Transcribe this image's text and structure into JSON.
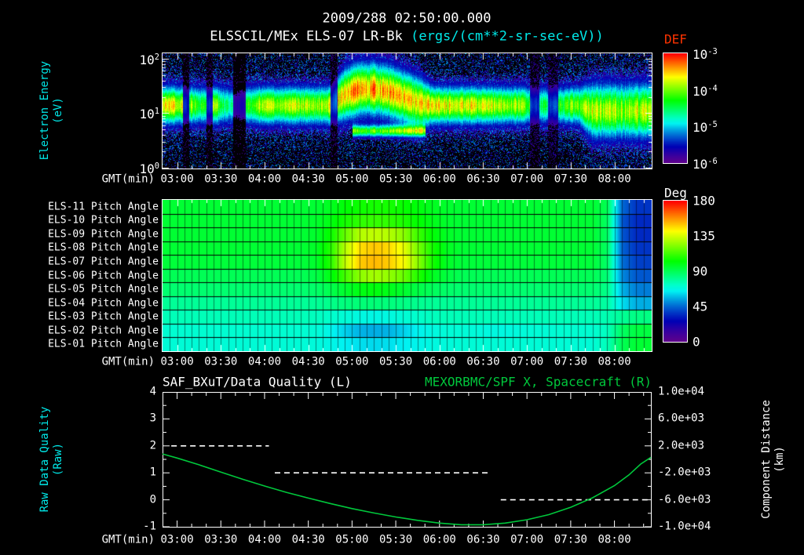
{
  "title": {
    "datetime": "2009/288 02:50:00.000",
    "instrument": "ELSSCIL/MEx ELS-07 LR-Bk",
    "units": " (ergs/(cm**2-sr-sec-eV))"
  },
  "colors": {
    "background": "#000000",
    "text": "#ffffff",
    "cyan": "#00e8e8",
    "green": "#00c83c",
    "red": "#ff3300"
  },
  "time_axis": {
    "label": "GMT(min)",
    "start": "02:50",
    "end": "08:25",
    "major_ticks": [
      "03:00",
      "03:30",
      "04:00",
      "04:30",
      "05:00",
      "05:30",
      "06:00",
      "06:30",
      "07:00",
      "07:30",
      "08:00"
    ],
    "minor_tick_minutes": 10
  },
  "chart_data": [
    {
      "type": "heatmap",
      "name": "electron-energy-spectrogram",
      "title": "ELSSCIL/MEx ELS-07 LR-Bk",
      "units": "ergs/(cm**2-sr-sec-eV)",
      "ylabel_lines": [
        "Electron Energy",
        "(eV)"
      ],
      "yscale": "log",
      "ylim_ev": [
        1,
        126
      ],
      "yticks": [
        {
          "text": "10^2",
          "log10": 2
        },
        {
          "text": "10^1",
          "log10": 1
        },
        {
          "text": "10^0",
          "log10": 0
        }
      ],
      "colorbar": {
        "label": "DEF",
        "ticks": [
          "10^-3",
          "10^-4",
          "10^-5",
          "10^-6"
        ],
        "range_log10": [
          -6,
          -3
        ]
      },
      "model": {
        "description": "bright electron flux band near 10-40 eV across full interval; elevated/intensified 04:50-05:40; faint low-energy band ~5 eV 05:00-05:50; dark dropout columns; blue/purple speckle background",
        "bin_minutes": 10,
        "band_amp": [
          0.78,
          0.72,
          0.58,
          0.68,
          0.45,
          0.55,
          0.7,
          0.72,
          0.74,
          0.72,
          0.7,
          0.76,
          0.85,
          0.88,
          0.87,
          0.84,
          0.8,
          0.78,
          0.8,
          0.78,
          0.76,
          0.75,
          0.74,
          0.72,
          0.7,
          0.55,
          0.5,
          0.6,
          0.68,
          0.75,
          0.73,
          0.7,
          0.74,
          0.76
        ],
        "band_center_log10": [
          1.15,
          1.15,
          1.15,
          1.15,
          1.15,
          1.15,
          1.15,
          1.15,
          1.15,
          1.15,
          1.15,
          1.15,
          1.35,
          1.45,
          1.45,
          1.4,
          1.3,
          1.2,
          1.15,
          1.15,
          1.15,
          1.15,
          1.15,
          1.15,
          1.15,
          1.15,
          1.15,
          1.15,
          1.15,
          1.05,
          1.05,
          1.05,
          1.05,
          1.05
        ],
        "band_sigma_log10": [
          0.22,
          0.22,
          0.22,
          0.22,
          0.22,
          0.22,
          0.22,
          0.22,
          0.22,
          0.22,
          0.22,
          0.22,
          0.3,
          0.3,
          0.3,
          0.3,
          0.3,
          0.3,
          0.22,
          0.22,
          0.22,
          0.22,
          0.22,
          0.22,
          0.22,
          0.22,
          0.22,
          0.22,
          0.22,
          0.32,
          0.32,
          0.32,
          0.32,
          0.32
        ],
        "low_band": {
          "start_min": 130,
          "end_min": 180,
          "center_log10": 0.68,
          "amp": 0.6,
          "sigma_log10": 0.07
        },
        "dark_stripes_min": [
          [
            14,
            18,
            0.25
          ],
          [
            30,
            34,
            0.3
          ],
          [
            48,
            57,
            0.2
          ],
          [
            115,
            120,
            0.3
          ],
          [
            252,
            258,
            0.35
          ],
          [
            264,
            271,
            0.4
          ]
        ]
      }
    },
    {
      "type": "heatmap",
      "name": "pitch-angle-panels",
      "rows": [
        "ELS-11 Pitch Angle",
        "ELS-10 Pitch Angle",
        "ELS-09 Pitch Angle",
        "ELS-08 Pitch Angle",
        "ELS-07 Pitch Angle",
        "ELS-06 Pitch Angle",
        "ELS-05 Pitch Angle",
        "ELS-04 Pitch Angle",
        "ELS-03 Pitch Angle",
        "ELS-02 Pitch Angle",
        "ELS-01 Pitch Angle"
      ],
      "colorbar": {
        "label": "Deg",
        "ticks": [
          180,
          135,
          90,
          45,
          0
        ],
        "range": [
          0,
          180
        ]
      },
      "bin_minutes": 10,
      "values_deg": [
        [
          95,
          95,
          95,
          95,
          95,
          95,
          95,
          95,
          95,
          95,
          95,
          98,
          102,
          105,
          106,
          106,
          104,
          101,
          98,
          96,
          95,
          95,
          95,
          95,
          95,
          95,
          95,
          95,
          95,
          95,
          90,
          45,
          36,
          36
        ],
        [
          95,
          95,
          95,
          95,
          95,
          95,
          95,
          95,
          95,
          95,
          96,
          100,
          106,
          110,
          111,
          110,
          107,
          103,
          99,
          96,
          95,
          95,
          95,
          95,
          95,
          95,
          95,
          95,
          95,
          95,
          88,
          42,
          34,
          34
        ],
        [
          95,
          95,
          95,
          95,
          95,
          95,
          95,
          95,
          95,
          95,
          96,
          104,
          118,
          130,
          132,
          130,
          124,
          112,
          102,
          97,
          95,
          95,
          95,
          95,
          95,
          95,
          95,
          95,
          95,
          95,
          88,
          42,
          34,
          34
        ],
        [
          95,
          95,
          95,
          95,
          95,
          95,
          95,
          95,
          95,
          95,
          97,
          108,
          130,
          146,
          150,
          147,
          138,
          121,
          106,
          98,
          95,
          95,
          95,
          95,
          95,
          95,
          95,
          95,
          95,
          95,
          88,
          44,
          36,
          36
        ],
        [
          94,
          94,
          94,
          94,
          94,
          94,
          94,
          94,
          94,
          94,
          96,
          108,
          132,
          149,
          152,
          149,
          141,
          124,
          106,
          97,
          94,
          94,
          94,
          94,
          94,
          94,
          94,
          94,
          94,
          94,
          87,
          46,
          38,
          38
        ],
        [
          90,
          90,
          90,
          90,
          90,
          90,
          90,
          90,
          90,
          90,
          92,
          100,
          113,
          124,
          128,
          125,
          119,
          108,
          98,
          93,
          90,
          90,
          90,
          90,
          90,
          90,
          90,
          90,
          90,
          90,
          85,
          50,
          42,
          42
        ],
        [
          86,
          86,
          86,
          86,
          86,
          86,
          86,
          86,
          86,
          86,
          87,
          91,
          96,
          100,
          101,
          99,
          96,
          92,
          89,
          87,
          86,
          86,
          86,
          86,
          86,
          86,
          86,
          86,
          86,
          86,
          82,
          56,
          48,
          48
        ],
        [
          80,
          80,
          80,
          80,
          80,
          80,
          80,
          80,
          80,
          80,
          80,
          82,
          84,
          85,
          85,
          84,
          83,
          81,
          80,
          80,
          80,
          80,
          80,
          80,
          80,
          80,
          80,
          80,
          80,
          80,
          78,
          62,
          55,
          55
        ],
        [
          75,
          75,
          75,
          75,
          75,
          75,
          75,
          75,
          75,
          75,
          74,
          72,
          70,
          68,
          67,
          68,
          70,
          72,
          74,
          75,
          75,
          75,
          75,
          75,
          75,
          75,
          75,
          75,
          75,
          75,
          76,
          80,
          83,
          83
        ],
        [
          71,
          71,
          71,
          71,
          71,
          71,
          71,
          71,
          71,
          71,
          70,
          66,
          60,
          56,
          55,
          56,
          60,
          65,
          68,
          70,
          70,
          69,
          68,
          68,
          69,
          70,
          70,
          71,
          71,
          71,
          74,
          88,
          93,
          93
        ],
        [
          70,
          70,
          70,
          70,
          70,
          70,
          70,
          70,
          70,
          70,
          69,
          67,
          64,
          62,
          61,
          62,
          64,
          66,
          68,
          69,
          70,
          70,
          70,
          70,
          70,
          70,
          70,
          70,
          70,
          70,
          75,
          90,
          95,
          95
        ]
      ]
    },
    {
      "type": "line",
      "name": "quality-and-distance",
      "title_left": "SAF_BXuT/Data Quality (L)",
      "title_right": "MEXORBMC/SPF X, Spacecraft (R)",
      "left_axis": {
        "label_lines": [
          "Raw Data Quality",
          "(Raw)"
        ],
        "lim": [
          -1,
          4
        ],
        "ticks": [
          4,
          3,
          2,
          1,
          0,
          -1
        ]
      },
      "right_axis": {
        "label_lines": [
          "Component Distance",
          "(km)"
        ],
        "lim": [
          -10000,
          10000
        ],
        "ticks": [
          "1.0e+04",
          "6.0e+03",
          "2.0e+03",
          "-2.0e+03",
          "-6.0e+03",
          "-1.0e+04"
        ]
      },
      "quality_segments": [
        {
          "value": 2,
          "start": "02:56",
          "end": "04:03"
        },
        {
          "value": 1,
          "start": "04:07",
          "end": "06:33"
        },
        {
          "value": 0,
          "start": "06:42",
          "end": "08:25"
        }
      ],
      "distance_series": {
        "x": [
          "02:50",
          "03:00",
          "03:15",
          "03:30",
          "03:45",
          "04:00",
          "04:15",
          "04:30",
          "04:45",
          "05:00",
          "05:15",
          "05:30",
          "05:45",
          "06:00",
          "06:15",
          "06:30",
          "06:45",
          "07:00",
          "07:15",
          "07:30",
          "07:45",
          "08:00",
          "08:10",
          "08:18",
          "08:25"
        ],
        "y_km": [
          800,
          200,
          -800,
          -1900,
          -2950,
          -3950,
          -4900,
          -5750,
          -6550,
          -7300,
          -7950,
          -8550,
          -9050,
          -9450,
          -9700,
          -9700,
          -9450,
          -8950,
          -8200,
          -7100,
          -5700,
          -3900,
          -2300,
          -700,
          300
        ]
      }
    }
  ]
}
